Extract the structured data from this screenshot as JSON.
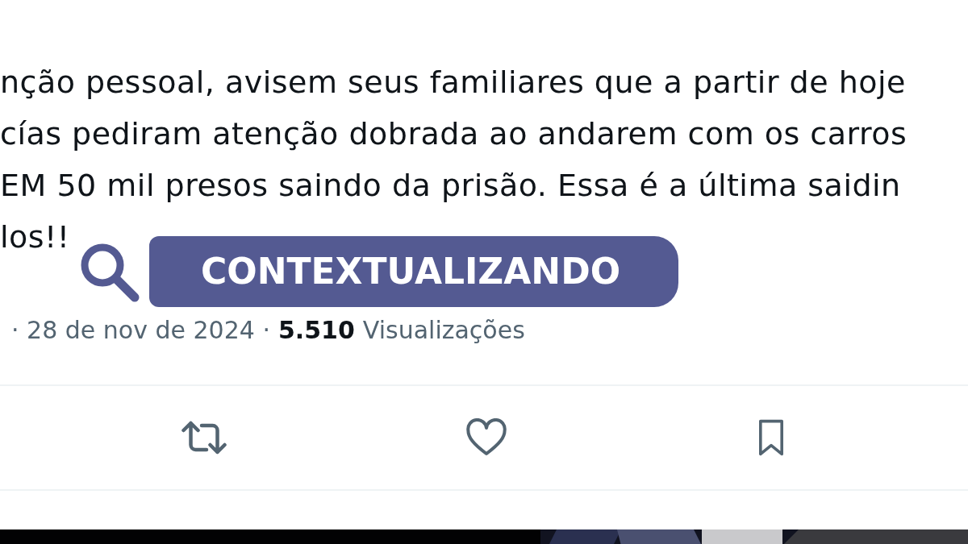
{
  "tweet": {
    "lines": [
      "nção pessoal, avisem seus familiares que a partir de hoje",
      "cías pediram atenção dobrada ao andarem com os carros",
      "EM 50 mil presos  saindo da prisão. Essa é a última saidin",
      "los!!"
    ],
    "meta": {
      "date": "· 28 de nov de 2024 ·",
      "views": "5.510",
      "views_label": "Visualizações"
    }
  },
  "banner": {
    "label": "CONTEXTUALIZANDO"
  }
}
